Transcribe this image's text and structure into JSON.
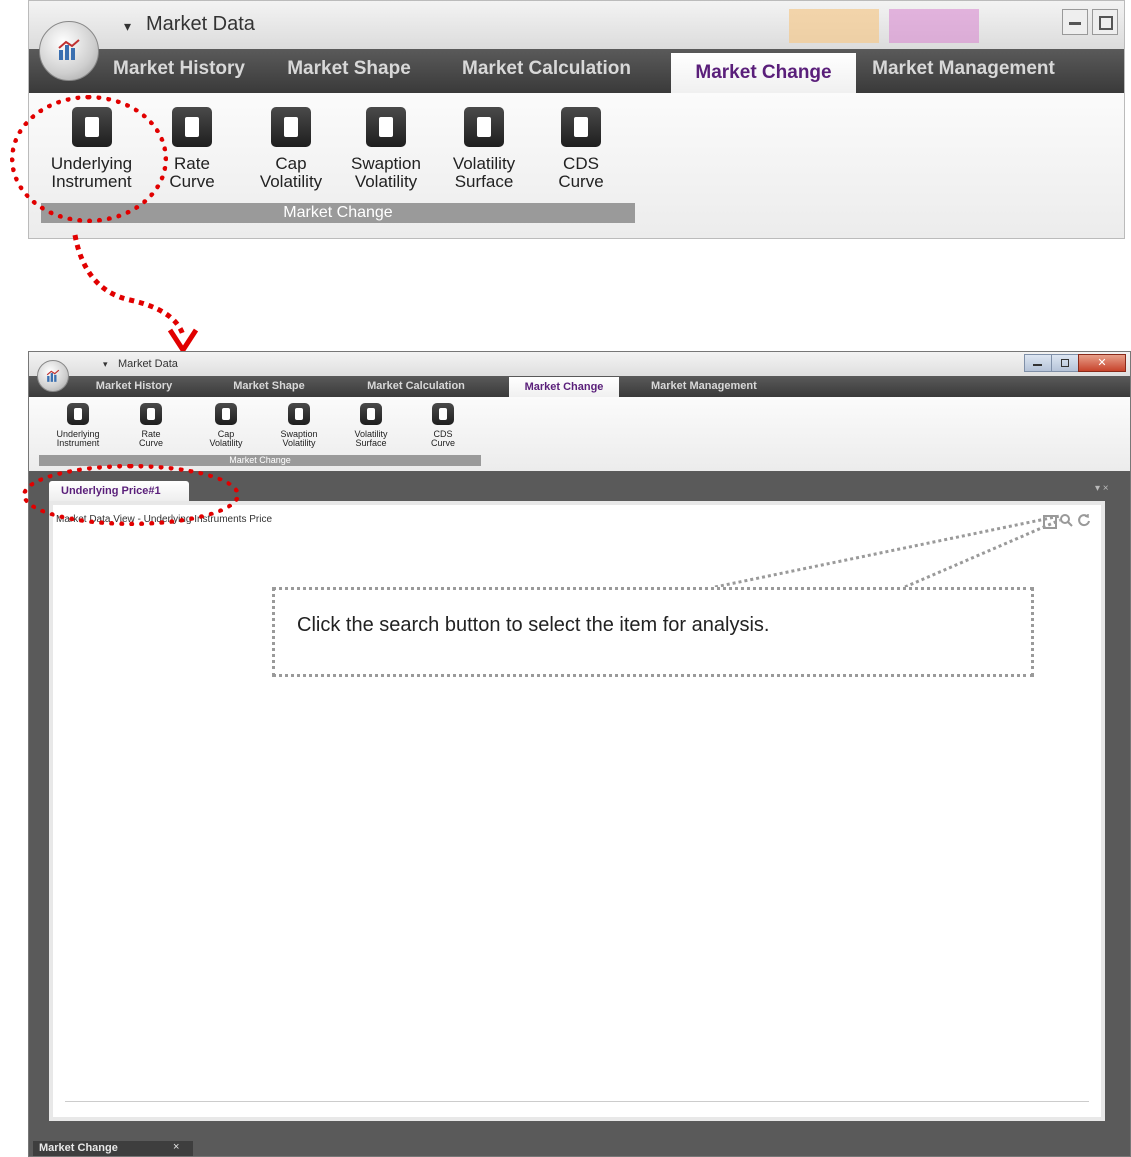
{
  "top": {
    "title": "Market Data",
    "tabs": [
      "Market History",
      "Market Shape",
      "Market Calculation",
      "Market Change",
      "Market Management"
    ],
    "active_tab": "Market Change",
    "buttons": [
      {
        "line1": "Underlying",
        "line2": "Instrument"
      },
      {
        "line1": "Rate",
        "line2": "Curve"
      },
      {
        "line1": "Cap",
        "line2": "Volatility"
      },
      {
        "line1": "Swaption",
        "line2": "Volatility"
      },
      {
        "line1": "Volatility",
        "line2": "Surface"
      },
      {
        "line1": "CDS",
        "line2": "Curve"
      }
    ],
    "group_label": "Market Change"
  },
  "bottom": {
    "title": "Market Data",
    "tabs": [
      "Market History",
      "Market Shape",
      "Market Calculation",
      "Market Change",
      "Market Management"
    ],
    "buttons": [
      {
        "line1": "Underlying",
        "line2": "Instrument"
      },
      {
        "line1": "Rate",
        "line2": "Curve"
      },
      {
        "line1": "Cap",
        "line2": "Volatility"
      },
      {
        "line1": "Swaption",
        "line2": "Volatility"
      },
      {
        "line1": "Volatility",
        "line2": "Surface"
      },
      {
        "line1": "CDS",
        "line2": "Curve"
      }
    ],
    "group_label": "Market Change",
    "doc_tab": "Underlying Price#1",
    "view_title": "Market Data View - Underlying Instruments Price",
    "status_tab": "Market Change",
    "status_close": "×",
    "panel_controls": "▾ ×"
  },
  "callout_text": "Click the search button to select the item for analysis.",
  "icons": {
    "window_minimize": "minimize-icon",
    "window_restore": "restore-icon",
    "search": "search-icon",
    "refresh": "refresh-icon"
  },
  "colors": {
    "annotation": "#e10000",
    "active_tab_text": "#5a1f7a",
    "tab_bar": "#444444"
  }
}
